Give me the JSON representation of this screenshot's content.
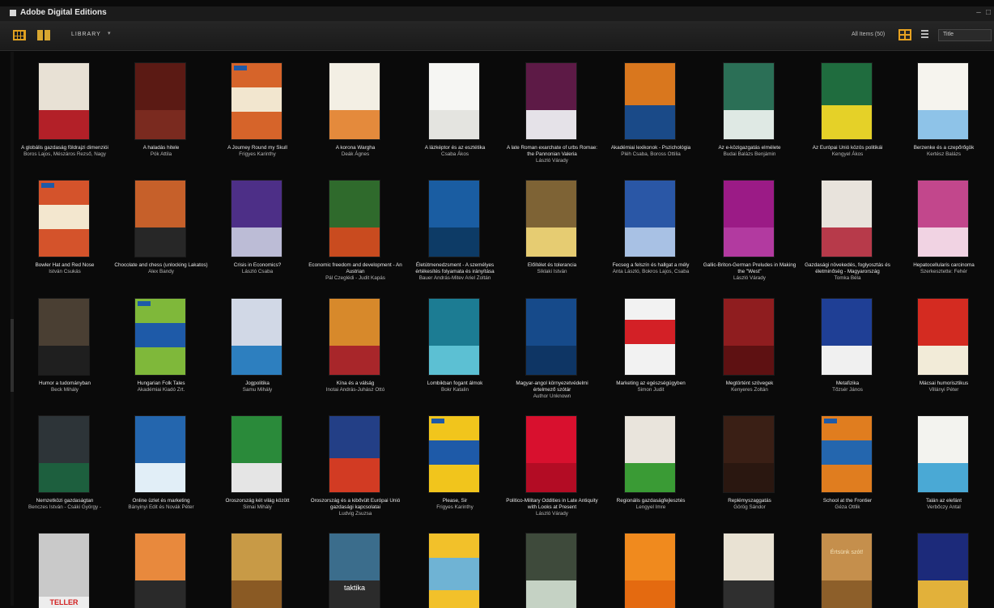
{
  "window": {
    "title": "Adobe Digital Editions",
    "minimize": "–",
    "close": "□"
  },
  "toolbar": {
    "library_label": "LIBRARY",
    "library_caret": "▾",
    "all_items": "All Items (50)",
    "sort_value": "Title"
  },
  "colors": {
    "accent": "#e7a221",
    "background": "#0a0a0a"
  },
  "books": [
    {
      "title": "A globális gazdaság földrajzi dimenziói",
      "author": "Boros Lajos, Mészáros Rezső, Nagy",
      "cover": {
        "bg": "#b32028",
        "band": "#e8e1d5",
        "kind": "globe"
      }
    },
    {
      "title": "A haladás hitele",
      "author": "Pók Attila",
      "cover": {
        "bg": "#5b1a14",
        "band": "#7a2a1f",
        "kind": "plain"
      }
    },
    {
      "title": "A Journey Round my Skull",
      "author": "Frigyes Karinthy",
      "cover": {
        "bg": "#d6642a",
        "band": "#f2e6cf",
        "kind": "budget"
      }
    },
    {
      "title": "A korona Wargha",
      "author": "Deák Ágnes",
      "cover": {
        "bg": "#e48a3c",
        "band": "#f3efe4",
        "kind": "sketch"
      }
    },
    {
      "title": "A lázképtor és az esztétika",
      "author": "Csaba Ákos",
      "cover": {
        "bg": "#f6f6f3",
        "band": "#e4e4e0",
        "kind": "white"
      }
    },
    {
      "title": "A late Roman exarchate of urbs Romae: the Pannonian Valeria",
      "author": "László Várady",
      "cover": {
        "bg": "#5d1a46",
        "band": "#e5e2e8",
        "kind": "photo"
      }
    },
    {
      "title": "Akadémiai lexikonok - Pszichológia",
      "author": "Pléh Csaba, Boross Ottilia",
      "cover": {
        "bg": "#d9771e",
        "band": "#1a4a88",
        "kind": "tiles"
      }
    },
    {
      "title": "Az e-közigazgatás elmélete",
      "author": "Budai Balázs Benjámin",
      "cover": {
        "bg": "#dfe9e4",
        "band": "#2b6f56",
        "kind": "leaf"
      }
    },
    {
      "title": "Az Európai Unió közös politikái",
      "author": "Kengyel Ákos",
      "cover": {
        "bg": "#1f6c3e",
        "band": "#e5d128",
        "kind": "eu"
      }
    },
    {
      "title": "Berzenke és a czepőrőgök",
      "author": "Kertész Balázs",
      "cover": {
        "bg": "#f6f4ee",
        "band": "#8ec3e8",
        "kind": "kids"
      }
    },
    {
      "title": "Bowler Hat and Red Nose",
      "author": "István Csukás",
      "cover": {
        "bg": "#d4532b",
        "band": "#f3e7cf",
        "kind": "budget"
      }
    },
    {
      "title": "Chocolate and chess (unlocking Lakatos)",
      "author": "Alex Bandy",
      "cover": {
        "bg": "#c6602a",
        "band": "#272727",
        "kind": "choc"
      }
    },
    {
      "title": "Crisis in Economics?",
      "author": "László Csaba",
      "cover": {
        "bg": "#4d2f87",
        "band": "#bcbcd6",
        "kind": "purple"
      }
    },
    {
      "title": "Economic freedom and development - An Austrian",
      "author": "Pál Czeglédi - Judit Kapás",
      "cover": {
        "bg": "#2f6a2c",
        "band": "#c94b1f",
        "kind": "bars"
      }
    },
    {
      "title": "Életútmenedzsment - A személyes értékesítés folyamata és irányítása",
      "author": "Bauer András-Mitev Ariel Zoltán",
      "cover": {
        "bg": "#1a5da2",
        "band": "#0d3b66",
        "kind": "blue"
      }
    },
    {
      "title": "Előítélet és tolerancia",
      "author": "Síklaki István",
      "cover": {
        "bg": "#7e6335",
        "band": "#e6cc72",
        "kind": "sign"
      }
    },
    {
      "title": "Fecseg a felszín és hallgat a mély",
      "author": "Anta László, Bokros Lajos, Csaba",
      "cover": {
        "bg": "#2a57a6",
        "band": "#a8c1e4",
        "kind": "globe2"
      }
    },
    {
      "title": "Gallic-Briton-German Preludes in Making the \"West\"",
      "author": "László Várady",
      "cover": {
        "bg": "#9b1b86",
        "band": "#b23aa0",
        "kind": "plain"
      }
    },
    {
      "title": "Gazdasági növekedés, foglyosztás és életminőség - Magyarország",
      "author": "Tomka Béla",
      "cover": {
        "bg": "#e8e3dc",
        "band": "#b73a4a",
        "kind": "grid"
      }
    },
    {
      "title": "Hepatocellularis carcinoma",
      "author": "Szerkesztette: Fehér",
      "cover": {
        "bg": "#c2478c",
        "band": "#f1d3e3",
        "kind": "micro"
      }
    },
    {
      "title": "Humor a tudományban",
      "author": "Beck Mihály",
      "cover": {
        "bg": "#4a3f33",
        "band": "#1f1f1f",
        "kind": "stone"
      }
    },
    {
      "title": "Hungarian Folk Tales",
      "author": "Akadémiai Kiadó Zrt.",
      "cover": {
        "bg": "#7fb83a",
        "band": "#1e5aa8",
        "kind": "budget"
      }
    },
    {
      "title": "Jogpolitika",
      "author": "Samu Mihály",
      "cover": {
        "bg": "#d1d8e6",
        "band": "#2d7fbf",
        "kind": "people"
      }
    },
    {
      "title": "Kína és a válság",
      "author": "Inotai András-Juhász Ottó",
      "cover": {
        "bg": "#d7892b",
        "band": "#a8262a",
        "kind": "buddha"
      }
    },
    {
      "title": "Lombikban fogant álmok",
      "author": "Bokr Katalin",
      "cover": {
        "bg": "#1c7c93",
        "band": "#5cc0d3",
        "kind": "teal"
      }
    },
    {
      "title": "Magyar-angol környezetvédelmi értelmező szótár",
      "author": "Author Unknown",
      "cover": {
        "bg": "#164a8a",
        "band": "#0e3564",
        "kind": "dict"
      }
    },
    {
      "title": "Marketing az egészségügyben",
      "author": "Simon Judit",
      "cover": {
        "bg": "#f2f2f2",
        "band": "#d32026",
        "kind": "chair"
      }
    },
    {
      "title": "Megtörtént szövegek",
      "author": "Kenyeres Zoltán",
      "cover": {
        "bg": "#8f1d1f",
        "band": "#5e1112",
        "kind": "red"
      }
    },
    {
      "title": "Metafizika",
      "author": "Tőzsér János",
      "cover": {
        "bg": "#1f3f95",
        "band": "#f0f0f0",
        "kind": "meta"
      }
    },
    {
      "title": "Mácsai humorisztikus",
      "author": "Villányi Péter",
      "cover": {
        "bg": "#d42b21",
        "band": "#f2ebd8",
        "kind": "mac"
      }
    },
    {
      "title": "Nemzetközi gazdaságtan",
      "author": "Benczes István - Csáki György -",
      "cover": {
        "bg": "#2d3438",
        "band": "#1d5f3e",
        "kind": "diamond"
      }
    },
    {
      "title": "Online üzlet és marketing",
      "author": "Bányinyi Edit és Novák Péter",
      "cover": {
        "bg": "#2466ae",
        "band": "#e1eef7",
        "kind": "chart"
      }
    },
    {
      "title": "Oroszország két világ között",
      "author": "Simai Mihály",
      "cover": {
        "bg": "#2a8a3a",
        "band": "#e5e5e5",
        "kind": "bottle"
      }
    },
    {
      "title": "Oroszország és a kibővült Európai Unió gazdasági kapcsolatai",
      "author": "Ludvig Zsuzsa",
      "cover": {
        "bg": "#233f86",
        "band": "#d23b23",
        "kind": "flag"
      }
    },
    {
      "title": "Please, Sir",
      "author": "Frigyes Karinthy",
      "cover": {
        "bg": "#f1c51c",
        "band": "#1e5aa8",
        "kind": "budget"
      }
    },
    {
      "title": "Politico-Military Oddities in Late Antiquity with Looks at Present",
      "author": "László Várady",
      "cover": {
        "bg": "#d8102e",
        "band": "#b30c24",
        "kind": "plain"
      }
    },
    {
      "title": "Regionális gazdaságfejlesztés",
      "author": "Lengyel Imre",
      "cover": {
        "bg": "#e9e4dc",
        "band": "#3a9b35",
        "kind": "puzzle"
      }
    },
    {
      "title": "Replémyszaggatás",
      "author": "Görög Sándor",
      "cover": {
        "bg": "#3a1f15",
        "band": "#2a1710",
        "kind": "dark"
      }
    },
    {
      "title": "School at the Frontier",
      "author": "Géza Ottlik",
      "cover": {
        "bg": "#e07d1f",
        "band": "#2466ae",
        "kind": "budget"
      }
    },
    {
      "title": "Talán az elefánt",
      "author": "Verbőczy Antal",
      "cover": {
        "bg": "#f3f3ef",
        "band": "#4aa9d5",
        "kind": "kids2"
      }
    },
    {
      "title": "",
      "author": "",
      "cover": {
        "bg": "#ededed",
        "band": "#c9c9c9",
        "kind": "teller",
        "label": "TELLER"
      }
    },
    {
      "title": "",
      "author": "",
      "cover": {
        "bg": "#e8893d",
        "band": "#2a2a2a",
        "kind": "sunset"
      }
    },
    {
      "title": "",
      "author": "",
      "cover": {
        "bg": "#c89a46",
        "band": "#8a5a24",
        "kind": "body"
      }
    },
    {
      "title": "",
      "author": "",
      "cover": {
        "bg": "#3b6d8c",
        "band": "#2b2b2b",
        "kind": "taktika",
        "label": "taktika"
      }
    },
    {
      "title": "",
      "author": "",
      "cover": {
        "bg": "#f2c12a",
        "band": "#6fb3d4",
        "kind": "beach"
      }
    },
    {
      "title": "",
      "author": "",
      "cover": {
        "bg": "#3e4a3b",
        "band": "#c5d2c4",
        "kind": "forest"
      }
    },
    {
      "title": "",
      "author": "",
      "cover": {
        "bg": "#f08a1e",
        "band": "#e46a10",
        "kind": "hex"
      }
    },
    {
      "title": "",
      "author": "",
      "cover": {
        "bg": "#e9e2d3",
        "band": "#2f2f2f",
        "kind": "oldphoto"
      }
    },
    {
      "title": "",
      "author": "",
      "cover": {
        "bg": "#c58f4c",
        "band": "#8d5f2a",
        "kind": "ertsunk",
        "label": "Értsünk szót!"
      }
    },
    {
      "title": "",
      "author": "",
      "cover": {
        "bg": "#1c2a7a",
        "band": "#e2b13a",
        "kind": "navy"
      }
    }
  ]
}
